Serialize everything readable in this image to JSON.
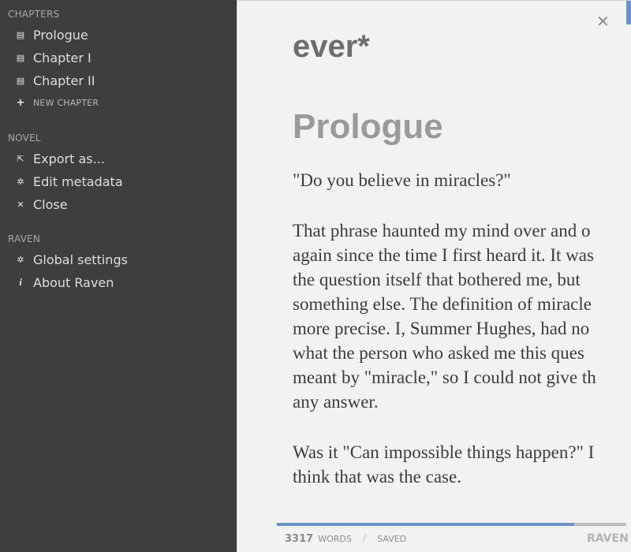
{
  "sidebar": {
    "chapters_heading": "CHAPTERS",
    "chapters": [
      {
        "label": "Prologue",
        "icon": "document-icon"
      },
      {
        "label": "Chapter I",
        "icon": "document-icon"
      },
      {
        "label": "Chapter II",
        "icon": "document-icon"
      }
    ],
    "new_chapter_label": "NEW CHAPTER",
    "novel_heading": "NOVEL",
    "novel_items": [
      {
        "label": "Export as...",
        "icon": "export-icon"
      },
      {
        "label": "Edit metadata",
        "icon": "gear-icon"
      },
      {
        "label": "Close",
        "icon": "close-icon"
      }
    ],
    "raven_heading": "RAVEN",
    "raven_items": [
      {
        "label": "Global settings",
        "icon": "gear-icon"
      },
      {
        "label": "About Raven",
        "icon": "info-icon"
      }
    ]
  },
  "editor": {
    "novel_title": "ever*",
    "chapter_title": "Prologue",
    "paragraphs": [
      "\"Do you believe in miracles?\"",
      "That phrase haunted my mind over and o\nagain since the time I first heard it. It was\nthe question itself that bothered me, but\nsomething else. The definition of miracle\nmore precise. I, Summer Hughes, had no\nwhat the person who asked me this ques\nmeant by \"miracle,\" so I could not give th\nany answer.",
      "Was it \"Can impossible things happen?\" I\nthink that was the case."
    ]
  },
  "status": {
    "word_count": "3317",
    "words_label": "WORDS",
    "separator": "/",
    "saved_label": "SAVED",
    "brand": "RAVEN",
    "progress_fraction": 0.85
  },
  "colors": {
    "accent": "#6b93c5",
    "sidebar_bg": "#3e3e3e",
    "editor_bg": "#f2f2f2"
  }
}
